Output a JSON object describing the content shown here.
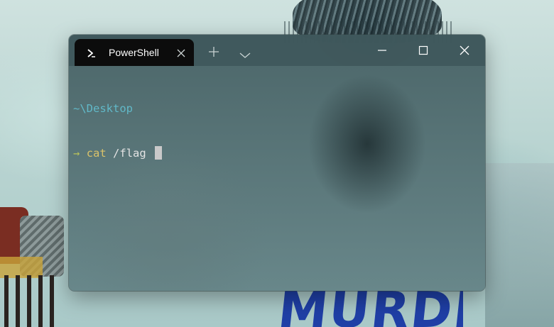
{
  "window": {
    "tab_title": "PowerShell",
    "tab_icon": "powershell-icon",
    "new_tab_icon": "plus-icon",
    "dropdown_icon": "chevron-down-icon",
    "controls": [
      "minimize-icon",
      "maximize-icon",
      "close-icon"
    ]
  },
  "terminal": {
    "path": "~\\Desktop",
    "prompt_symbol": "→",
    "command": "cat",
    "argument": "/flag"
  },
  "wallpaper": {
    "text": "MURDER"
  },
  "colors": {
    "tab_background": "#0c0c0c",
    "path": "#61b8c8",
    "prompt_arrow": "#b9c35a",
    "command": "#d9c26a",
    "argument": "#e3e3e3",
    "cursor": "#c9c9c9"
  }
}
